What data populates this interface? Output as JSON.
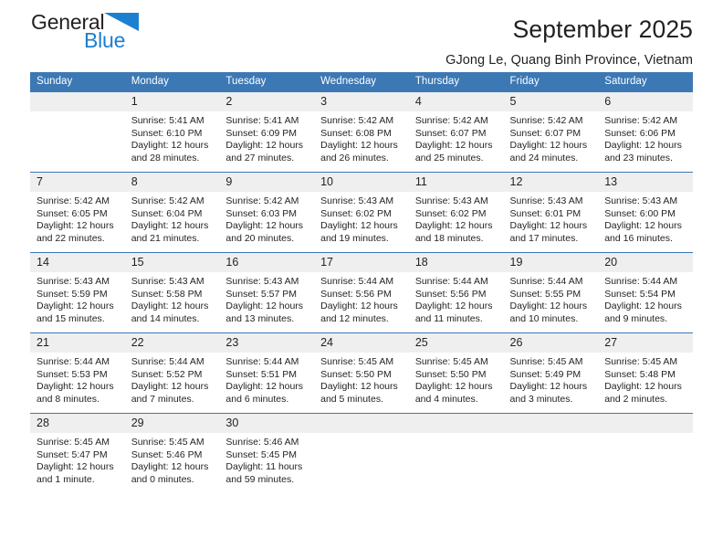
{
  "logo": {
    "word_top": "General",
    "word_bottom": "Blue",
    "triangle_icon": "triangle-icon",
    "color_text": "#231f20",
    "color_blue": "#1c7fd0"
  },
  "header": {
    "title": "September 2025",
    "subtitle": "GJong Le, Quang Binh Province, Vietnam"
  },
  "theme": {
    "header_blue": "#3c78b4",
    "daynum_gray": "#efefef",
    "text": "#231f20"
  },
  "weekday_headers": [
    "Sunday",
    "Monday",
    "Tuesday",
    "Wednesday",
    "Thursday",
    "Friday",
    "Saturday"
  ],
  "weeks": [
    [
      {
        "day": "",
        "lines": []
      },
      {
        "day": "1",
        "lines": [
          "Sunrise: 5:41 AM",
          "Sunset: 6:10 PM",
          "Daylight: 12 hours",
          "and 28 minutes."
        ]
      },
      {
        "day": "2",
        "lines": [
          "Sunrise: 5:41 AM",
          "Sunset: 6:09 PM",
          "Daylight: 12 hours",
          "and 27 minutes."
        ]
      },
      {
        "day": "3",
        "lines": [
          "Sunrise: 5:42 AM",
          "Sunset: 6:08 PM",
          "Daylight: 12 hours",
          "and 26 minutes."
        ]
      },
      {
        "day": "4",
        "lines": [
          "Sunrise: 5:42 AM",
          "Sunset: 6:07 PM",
          "Daylight: 12 hours",
          "and 25 minutes."
        ]
      },
      {
        "day": "5",
        "lines": [
          "Sunrise: 5:42 AM",
          "Sunset: 6:07 PM",
          "Daylight: 12 hours",
          "and 24 minutes."
        ]
      },
      {
        "day": "6",
        "lines": [
          "Sunrise: 5:42 AM",
          "Sunset: 6:06 PM",
          "Daylight: 12 hours",
          "and 23 minutes."
        ]
      }
    ],
    [
      {
        "day": "7",
        "lines": [
          "Sunrise: 5:42 AM",
          "Sunset: 6:05 PM",
          "Daylight: 12 hours",
          "and 22 minutes."
        ]
      },
      {
        "day": "8",
        "lines": [
          "Sunrise: 5:42 AM",
          "Sunset: 6:04 PM",
          "Daylight: 12 hours",
          "and 21 minutes."
        ]
      },
      {
        "day": "9",
        "lines": [
          "Sunrise: 5:42 AM",
          "Sunset: 6:03 PM",
          "Daylight: 12 hours",
          "and 20 minutes."
        ]
      },
      {
        "day": "10",
        "lines": [
          "Sunrise: 5:43 AM",
          "Sunset: 6:02 PM",
          "Daylight: 12 hours",
          "and 19 minutes."
        ]
      },
      {
        "day": "11",
        "lines": [
          "Sunrise: 5:43 AM",
          "Sunset: 6:02 PM",
          "Daylight: 12 hours",
          "and 18 minutes."
        ]
      },
      {
        "day": "12",
        "lines": [
          "Sunrise: 5:43 AM",
          "Sunset: 6:01 PM",
          "Daylight: 12 hours",
          "and 17 minutes."
        ]
      },
      {
        "day": "13",
        "lines": [
          "Sunrise: 5:43 AM",
          "Sunset: 6:00 PM",
          "Daylight: 12 hours",
          "and 16 minutes."
        ]
      }
    ],
    [
      {
        "day": "14",
        "lines": [
          "Sunrise: 5:43 AM",
          "Sunset: 5:59 PM",
          "Daylight: 12 hours",
          "and 15 minutes."
        ]
      },
      {
        "day": "15",
        "lines": [
          "Sunrise: 5:43 AM",
          "Sunset: 5:58 PM",
          "Daylight: 12 hours",
          "and 14 minutes."
        ]
      },
      {
        "day": "16",
        "lines": [
          "Sunrise: 5:43 AM",
          "Sunset: 5:57 PM",
          "Daylight: 12 hours",
          "and 13 minutes."
        ]
      },
      {
        "day": "17",
        "lines": [
          "Sunrise: 5:44 AM",
          "Sunset: 5:56 PM",
          "Daylight: 12 hours",
          "and 12 minutes."
        ]
      },
      {
        "day": "18",
        "lines": [
          "Sunrise: 5:44 AM",
          "Sunset: 5:56 PM",
          "Daylight: 12 hours",
          "and 11 minutes."
        ]
      },
      {
        "day": "19",
        "lines": [
          "Sunrise: 5:44 AM",
          "Sunset: 5:55 PM",
          "Daylight: 12 hours",
          "and 10 minutes."
        ]
      },
      {
        "day": "20",
        "lines": [
          "Sunrise: 5:44 AM",
          "Sunset: 5:54 PM",
          "Daylight: 12 hours",
          "and 9 minutes."
        ]
      }
    ],
    [
      {
        "day": "21",
        "lines": [
          "Sunrise: 5:44 AM",
          "Sunset: 5:53 PM",
          "Daylight: 12 hours",
          "and 8 minutes."
        ]
      },
      {
        "day": "22",
        "lines": [
          "Sunrise: 5:44 AM",
          "Sunset: 5:52 PM",
          "Daylight: 12 hours",
          "and 7 minutes."
        ]
      },
      {
        "day": "23",
        "lines": [
          "Sunrise: 5:44 AM",
          "Sunset: 5:51 PM",
          "Daylight: 12 hours",
          "and 6 minutes."
        ]
      },
      {
        "day": "24",
        "lines": [
          "Sunrise: 5:45 AM",
          "Sunset: 5:50 PM",
          "Daylight: 12 hours",
          "and 5 minutes."
        ]
      },
      {
        "day": "25",
        "lines": [
          "Sunrise: 5:45 AM",
          "Sunset: 5:50 PM",
          "Daylight: 12 hours",
          "and 4 minutes."
        ]
      },
      {
        "day": "26",
        "lines": [
          "Sunrise: 5:45 AM",
          "Sunset: 5:49 PM",
          "Daylight: 12 hours",
          "and 3 minutes."
        ]
      },
      {
        "day": "27",
        "lines": [
          "Sunrise: 5:45 AM",
          "Sunset: 5:48 PM",
          "Daylight: 12 hours",
          "and 2 minutes."
        ]
      }
    ],
    [
      {
        "day": "28",
        "lines": [
          "Sunrise: 5:45 AM",
          "Sunset: 5:47 PM",
          "Daylight: 12 hours",
          "and 1 minute."
        ]
      },
      {
        "day": "29",
        "lines": [
          "Sunrise: 5:45 AM",
          "Sunset: 5:46 PM",
          "Daylight: 12 hours",
          "and 0 minutes."
        ]
      },
      {
        "day": "30",
        "lines": [
          "Sunrise: 5:46 AM",
          "Sunset: 5:45 PM",
          "Daylight: 11 hours",
          "and 59 minutes."
        ]
      },
      {
        "day": "",
        "lines": []
      },
      {
        "day": "",
        "lines": []
      },
      {
        "day": "",
        "lines": []
      },
      {
        "day": "",
        "lines": []
      }
    ]
  ]
}
